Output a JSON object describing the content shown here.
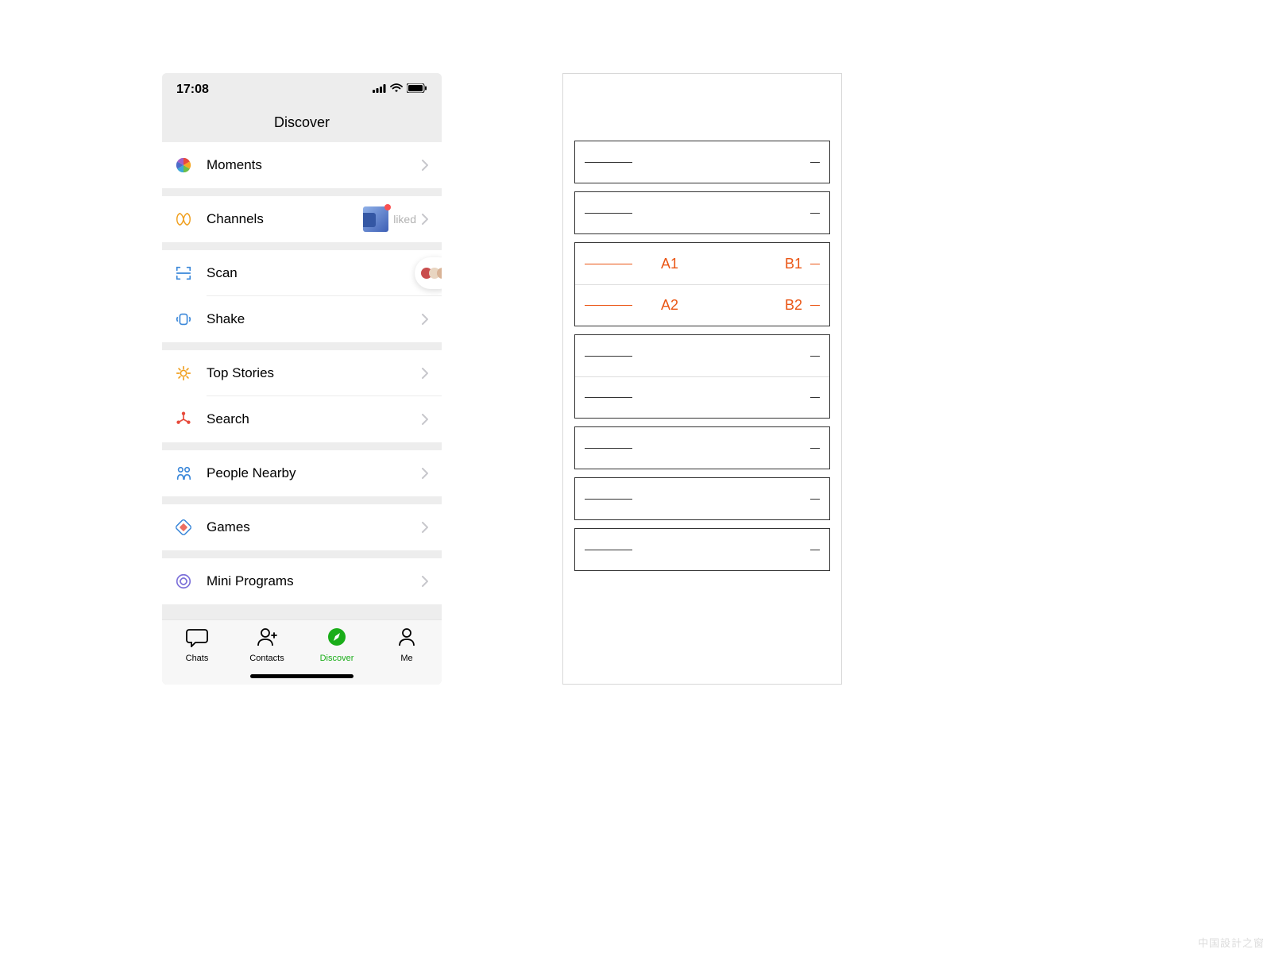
{
  "status": {
    "time": "17:08"
  },
  "nav": {
    "title": "Discover"
  },
  "groups": [
    {
      "cells": [
        {
          "key": "moments",
          "label": "Moments"
        }
      ]
    },
    {
      "cells": [
        {
          "key": "channels",
          "label": "Channels",
          "extra": "liked"
        }
      ]
    },
    {
      "cells": [
        {
          "key": "scan",
          "label": "Scan"
        },
        {
          "key": "shake",
          "label": "Shake"
        }
      ]
    },
    {
      "cells": [
        {
          "key": "topstories",
          "label": "Top Stories"
        },
        {
          "key": "search",
          "label": "Search"
        }
      ]
    },
    {
      "cells": [
        {
          "key": "nearby",
          "label": "People Nearby"
        }
      ]
    },
    {
      "cells": [
        {
          "key": "games",
          "label": "Games"
        }
      ]
    },
    {
      "cells": [
        {
          "key": "miniprograms",
          "label": "Mini Programs"
        }
      ]
    }
  ],
  "tabs": [
    {
      "key": "chats",
      "label": "Chats"
    },
    {
      "key": "contacts",
      "label": "Contacts"
    },
    {
      "key": "discover",
      "label": "Discover",
      "active": true
    },
    {
      "key": "me",
      "label": "Me"
    }
  ],
  "wireframe": {
    "annotations": {
      "a1": "A1",
      "a2": "A2",
      "b1": "B1",
      "b2": "B2"
    }
  },
  "watermark": "中国設計之窗"
}
